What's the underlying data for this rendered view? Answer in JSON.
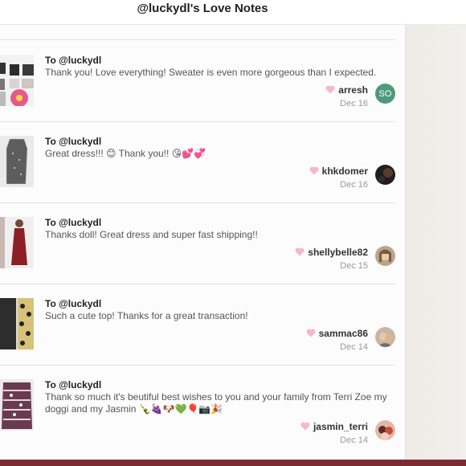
{
  "header": {
    "title": "@luckydl's Love Notes"
  },
  "notes": [
    {
      "to": "To @luckydl",
      "message": "Thank you! Love everything! Sweater is even more gorgeous than I expected.",
      "user": "arresh",
      "date": "Dec 16",
      "avatar_initials": "SO"
    },
    {
      "to": "To @luckydl",
      "message": "Great dress!!! 😊 Thank you!! 😘💕💞",
      "user": "khkdomer",
      "date": "Dec 16"
    },
    {
      "to": "To @luckydl",
      "message": "Thanks doll! Great dress and super fast shipping!!",
      "user": "shellybelle82",
      "date": "Dec 15"
    },
    {
      "to": "To @luckydl",
      "message": "Such a cute top! Thanks for a great transaction!",
      "user": "sammac86",
      "date": "Dec 14"
    },
    {
      "to": "To @luckydl",
      "message": "Thank so much it's beutiful best wishes to you and your family from Terri Zoe my doggi and my Jasmin 🍾🍇🐶💚🎈📷🎉",
      "user": "jasmin_terri",
      "date": "Dec 14"
    }
  ],
  "colors": {
    "heart": "#f6b8c1",
    "accent_bar": "#7b2c31",
    "avatar_initials_bg": "#4d9b7a"
  }
}
